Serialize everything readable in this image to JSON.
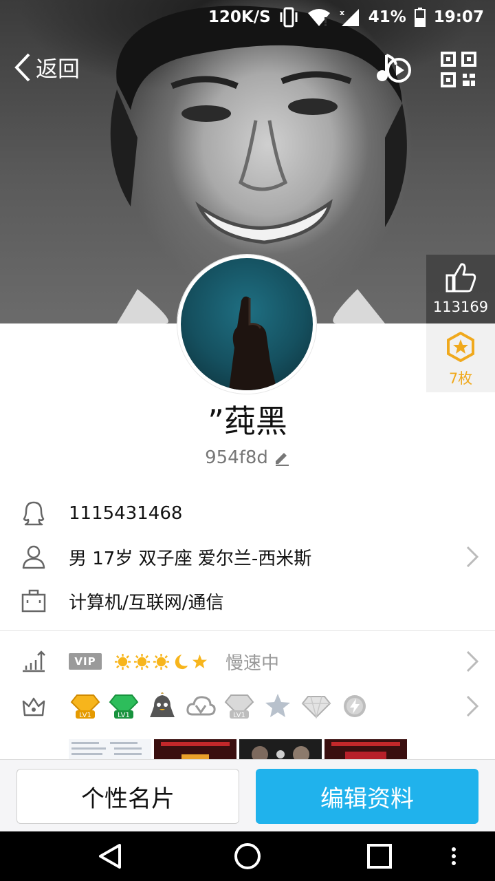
{
  "status_bar": {
    "net_speed": "120K/S",
    "battery": "41%",
    "time": "19:07",
    "icons": [
      "vibrate-icon",
      "wifi-icon",
      "cell-signal-icon",
      "battery-icon"
    ]
  },
  "header": {
    "back_label": "返回",
    "music_icon": "music-play-icon",
    "qr_icon": "qr-code-icon"
  },
  "like_panel": {
    "count": "113169",
    "icon": "thumbs-up-icon"
  },
  "medal_panel": {
    "count": "7枚",
    "icon": "medal-star-icon"
  },
  "profile": {
    "nickname": "”莼黑",
    "signature": "954f8d"
  },
  "info": {
    "qq_number": "1115431468",
    "basic": "男  17岁  双子座  爱尔兰-西米斯",
    "occupation": "计算机/互联网/通信"
  },
  "level": {
    "vip_label": "VIP",
    "icons": [
      "sun-icon",
      "sun-icon",
      "sun-icon",
      "moon-icon",
      "star-icon"
    ],
    "status": "慢速中"
  },
  "badges": {
    "items": [
      "gold-diamond-lv1-badge",
      "green-diamond-lv1-badge",
      "qq-penguin-badge",
      "cloud-v-badge",
      "silver-diamond-lv1-badge",
      "grey-star-badge",
      "grey-diamond-badge",
      "grey-lightning-badge"
    ]
  },
  "actions": {
    "card_label": "个性名片",
    "edit_label": "编辑资料"
  },
  "nav": {
    "icons": [
      "back-triangle-icon",
      "home-circle-icon",
      "recents-square-icon",
      "more-dots-icon"
    ]
  },
  "colors": {
    "accent": "#20b2ec",
    "medal": "#f0a91d"
  }
}
